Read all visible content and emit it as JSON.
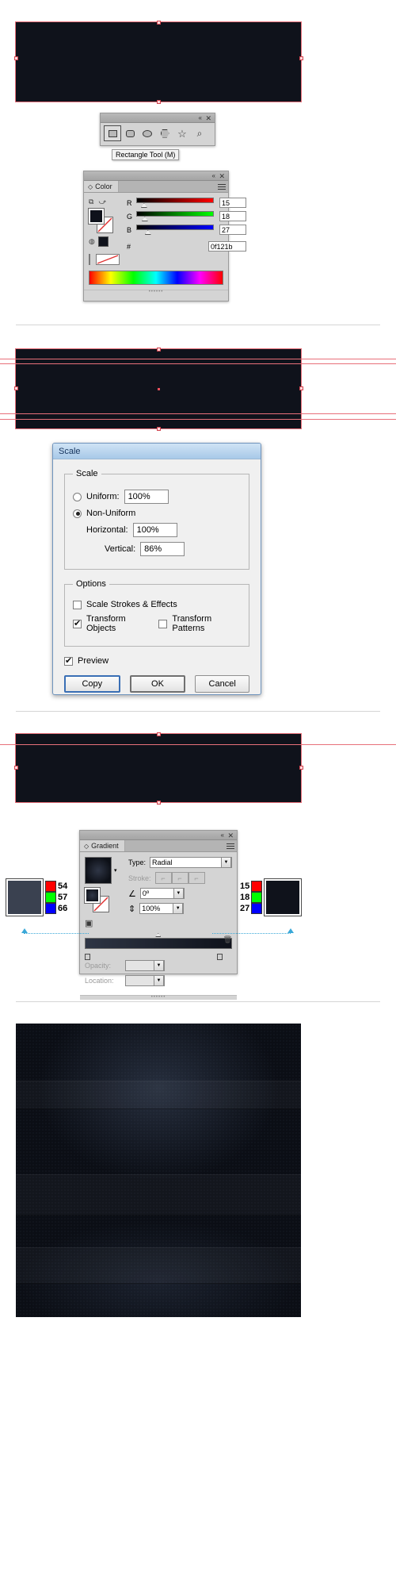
{
  "step1": {
    "canvas_fill": "#0f121b",
    "toolpalette": {
      "tools": [
        {
          "name": "rectangle-tool",
          "glyph": "▢",
          "selected": true
        },
        {
          "name": "rounded-rectangle-tool",
          "glyph": "▢",
          "selected": false
        },
        {
          "name": "ellipse-tool",
          "glyph": "⬭",
          "selected": false
        },
        {
          "name": "polygon-tool",
          "glyph": "⬡",
          "selected": false
        },
        {
          "name": "star-tool",
          "glyph": "☆",
          "selected": false
        },
        {
          "name": "flare-tool",
          "glyph": "✧",
          "selected": false
        }
      ],
      "tooltip": "Rectangle Tool (M)",
      "collapse_glyph": "«",
      "close_glyph": "✕"
    },
    "color_panel": {
      "tab_label": "Color",
      "tab_dia": "◇",
      "channels": [
        {
          "label": "R",
          "value": "15",
          "track_start": "#000000",
          "track_end": "#ff0000",
          "thumb_pct": 6
        },
        {
          "label": "G",
          "value": "18",
          "track_start": "#000000",
          "track_end": "#00ff00",
          "thumb_pct": 7
        },
        {
          "label": "B",
          "value": "27",
          "track_start": "#000000",
          "track_end": "#0000ff",
          "thumb_pct": 11
        }
      ],
      "hex_symbol": "#",
      "hex_value": "0f121b",
      "fill_color": "#0f121b",
      "collapse_glyph": "«",
      "close_glyph": "✕"
    }
  },
  "step2": {
    "dialog": {
      "title": "Scale",
      "scale_group": "Scale",
      "uniform_label": "Uniform:",
      "uniform_value": "100%",
      "uniform_selected": false,
      "nonuniform_label": "Non-Uniform",
      "nonuniform_selected": true,
      "horizontal_label": "Horizontal:",
      "horizontal_value": "100%",
      "vertical_label": "Vertical:",
      "vertical_value": "86%",
      "options_group": "Options",
      "scale_strokes_label": "Scale Strokes & Effects",
      "scale_strokes_checked": false,
      "transform_objects_label": "Transform Objects",
      "transform_objects_checked": true,
      "transform_patterns_label": "Transform Patterns",
      "transform_patterns_checked": false,
      "preview_label": "Preview",
      "preview_checked": true,
      "copy_button": "Copy",
      "ok_button": "OK",
      "cancel_button": "Cancel"
    }
  },
  "step3": {
    "gradient_panel": {
      "tab_label": "Gradient",
      "tab_dia": "◇",
      "type_label": "Type:",
      "type_value": "Radial",
      "stroke_label": "Stroke:",
      "angle_label": "∠",
      "angle_value": "0º",
      "aspect_label": "⇕",
      "aspect_value": "100%",
      "opacity_label": "Opacity:",
      "opacity_value": "",
      "location_label": "Location:",
      "location_value": "",
      "collapse_glyph": "«",
      "close_glyph": "✕"
    },
    "left_stop": {
      "swatch": "#3a4150",
      "r": "54",
      "g": "57",
      "b": "66",
      "r_color": "#ff0000",
      "g_color": "#00ff00",
      "b_color": "#0000ff"
    },
    "right_stop": {
      "swatch": "#0f121b",
      "r": "15",
      "g": "18",
      "b": "27",
      "r_color": "#ff0000",
      "g_color": "#00ff00",
      "b_color": "#0000ff"
    }
  }
}
